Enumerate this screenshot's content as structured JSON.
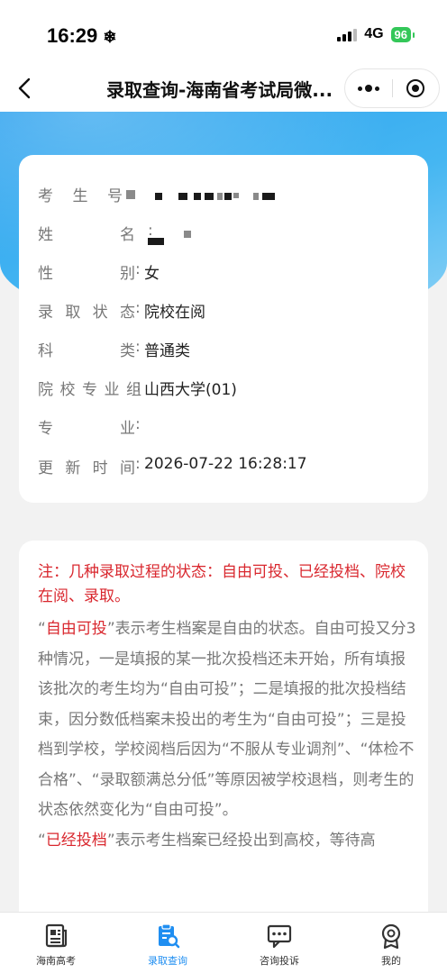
{
  "status_bar": {
    "time": "16:29",
    "network": "4G",
    "battery": "96"
  },
  "nav": {
    "title": "录取查询-海南省考试局微..."
  },
  "info": {
    "rows": [
      {
        "label": [
          "考",
          "生",
          "号"
        ],
        "value": ""
      },
      {
        "label": [
          "姓",
          "名"
        ],
        "value": ""
      },
      {
        "label": [
          "性",
          "别"
        ],
        "value": "女"
      },
      {
        "label": [
          "录",
          "取",
          "状",
          "态"
        ],
        "value": "院校在阅"
      },
      {
        "label": [
          "科",
          "类"
        ],
        "value": "普通类"
      },
      {
        "label": [
          "院",
          "校",
          "专",
          "业",
          "组"
        ],
        "value": "山西大学(01)"
      },
      {
        "label": [
          "专",
          "业"
        ],
        "value": ""
      },
      {
        "label": [
          "更",
          "新",
          "时",
          "间"
        ],
        "value": "2026-07-22 16:28:17"
      }
    ]
  },
  "note": {
    "title": "注：几种录取过程的状态：自由可投、已经投档、院校在阅、录取。",
    "p1_quote_open": "“",
    "p1_term": "自由可投",
    "p1_text": "”表示考生档案是自由的状态。自由可投又分3种情况，一是填报的某一批次投档还未开始，所有填报该批次的考生均为“自由可投”；二是填报的批次投档结束，因分数低档案未投出的考生为“自由可投”；三是投档到学校，学校阅档后因为“不服从专业调剂”、“体检不合格”、“录取额满总分低”等原因被学校退档，则考生的状态依然变化为“自由可投”。",
    "p2_quote_open": "“",
    "p2_term": "已经投档",
    "p2_text": "”表示考生档案已经投出到高校，等待高"
  },
  "tabs": [
    {
      "label": "海南高考",
      "icon": "news-icon"
    },
    {
      "label": "录取查询",
      "icon": "query-icon"
    },
    {
      "label": "咨询投诉",
      "icon": "chat-icon"
    },
    {
      "label": "我的",
      "icon": "profile-icon"
    }
  ],
  "colors": {
    "accent": "#1f8ef1",
    "highlight_red": "#d9272e",
    "banner": "#2aa0ee",
    "battery": "#34c759"
  }
}
